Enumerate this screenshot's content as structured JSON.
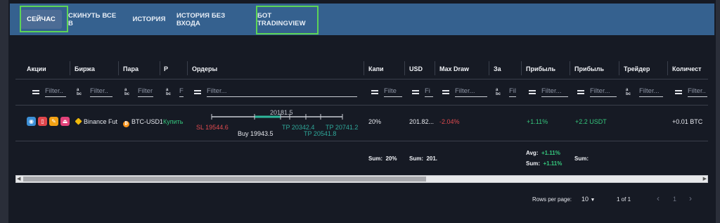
{
  "tabs": [
    "СЕЙЧАС",
    "СКИНУТЬ ВСЕ В",
    "ИСТОРИЯ",
    "ИСТОРИЯ БЕЗ ВХОДА",
    "БОТ TRADINGVIEW"
  ],
  "columns": [
    "Акции",
    "Биржа",
    "Пара",
    "Р",
    "Ордеры",
    "Капи",
    "USD",
    "Max Draw",
    "За",
    "Прибыль",
    "Прибыль",
    "Трейдер",
    "Количест"
  ],
  "filter_placeholder": "Filter",
  "filters": {
    "f1": "Filter..",
    "f2": "Filter..",
    "f3": "Filter",
    "f4": "F",
    "f5": "Filter...",
    "f6": "Filte",
    "f7": "Fi",
    "f8": "Filter...",
    "f9": "Fil",
    "f10": "Filter...",
    "f11": "Filter...",
    "f12": "Filter...",
    "f13": "Filter.."
  },
  "row": {
    "exchange": "Binance Futu",
    "pair": "BTC-USD1",
    "side": "Купить",
    "capital": "20%",
    "usd": "201.82...",
    "max_drawdown": "-2.04%",
    "profit_pct": "+1.11%",
    "profit_usdt": "+2.2 USDT",
    "quantity": "+0.01 BTC"
  },
  "orders": {
    "current": "20181.5",
    "sl": "SL 19544.6",
    "buy": "Buy 19943.5",
    "tp1": "TP 20342.4",
    "tp2": "TP 20741.2",
    "tp3": "TP 20541.8"
  },
  "summary": {
    "sum_label": "Sum:",
    "capital_sum": "20%",
    "usd_sum": "201.",
    "avg_label": "Avg:",
    "avg_value": "+1.11%",
    "profit_sum": "+1.11%"
  },
  "pagination": {
    "rows_label": "Rows per page:",
    "rows_value": "10",
    "range": "1 of 1",
    "page": "1"
  },
  "icons": [
    "eye-icon",
    "trash-icon",
    "pencil-icon",
    "eject-icon",
    "binance-icon",
    "btc-icon",
    "menu-icon",
    "text-filter-icon",
    "chevron-left-icon",
    "chevron-right-icon",
    "caret-down-icon"
  ],
  "colors": {
    "tabbar": "#35618f",
    "highlight": "#5cd456",
    "positive": "#35c77d",
    "negative": "#e04a4f",
    "panel": "#161a24"
  }
}
